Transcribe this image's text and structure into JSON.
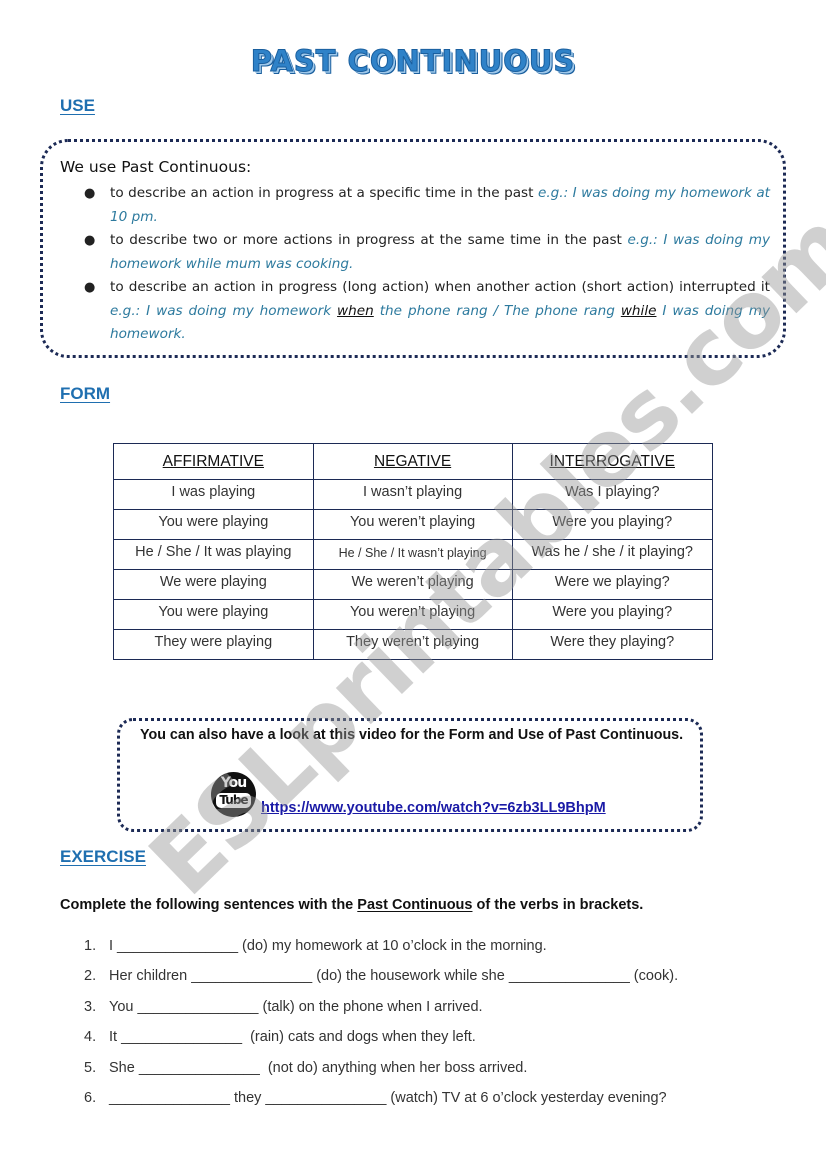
{
  "title": "PAST CONTINUOUS",
  "use": {
    "heading": "USE",
    "intro": "We use Past Continuous:",
    "items": [
      {
        "text": "to describe an action in progress at a specific time in the past ",
        "example": "e.g.: I was doing my homework at 10 pm."
      },
      {
        "text": "to describe two or more actions in progress at the same time in the past ",
        "example": "e.g.: I was doing my homework while mum was cooking."
      },
      {
        "text": "to describe an action in progress (long action) when another action (short action) interrupted it ",
        "example_parts": [
          "e.g.: I was doing my homework ",
          "when",
          " the phone rang / The phone rang ",
          "while",
          " I was doing my homework."
        ]
      }
    ]
  },
  "form": {
    "heading": "FORM",
    "headers": [
      "AFFIRMATIVE",
      "NEGATIVE",
      "INTERROGATIVE"
    ],
    "rows": [
      [
        "I was playing",
        "I wasn’t playing",
        "Was I playing?"
      ],
      [
        "You were playing",
        "You weren’t playing",
        "Were you playing?"
      ],
      [
        "He / She / It was playing",
        "He / She / It wasn’t playing",
        "Was he / she / it playing?"
      ],
      [
        "We were playing",
        "We weren’t playing",
        "Were we playing?"
      ],
      [
        "You were playing",
        "You weren’t playing",
        "Were you playing?"
      ],
      [
        "They were playing",
        "They weren’t playing",
        "Were they playing?"
      ]
    ]
  },
  "video": {
    "text": "You can also have a look at this video for the Form and Use of Past Continuous.",
    "icon_you": "You",
    "icon_tube": "Tube",
    "link": "https://www.youtube.com/watch?v=6zb3LL9BhpM"
  },
  "exercise": {
    "heading": "EXERCISE",
    "instructions_parts": [
      "Complete the following sentences with the ",
      "Past Continuous",
      " of the verbs in brackets."
    ],
    "items": [
      {
        "num": "1.",
        "text": "I _______________ (do) my homework at 10 o’clock in the morning."
      },
      {
        "num": "2.",
        "text": "Her children _______________ (do) the housework while she _______________ (cook)."
      },
      {
        "num": "3.",
        "text": "You _______________ (talk) on the phone when I arrived."
      },
      {
        "num": "4.",
        "text": "It _______________  (rain) cats and dogs when they left."
      },
      {
        "num": "5.",
        "text": "She _______________  (not do) anything when her boss arrived."
      },
      {
        "num": "6.",
        "text": "_______________ they _______________ (watch) TV at 6 o’clock yesterday evening?"
      }
    ]
  },
  "watermark": "ESLprintables.com"
}
